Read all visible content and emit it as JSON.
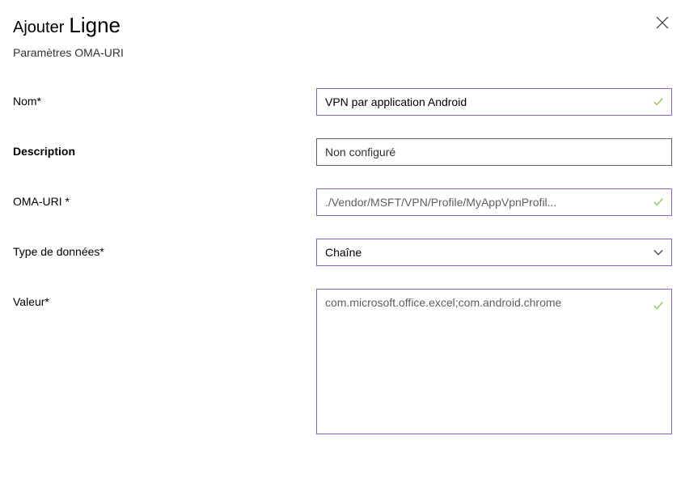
{
  "header": {
    "title_add": "Ajouter",
    "title_row": "Ligne",
    "subtitle": "Paramètres OMA-URI"
  },
  "form": {
    "name": {
      "label": "Nom*",
      "value": "VPN par application Android"
    },
    "description": {
      "label": "Description",
      "value": "Non configuré"
    },
    "oma_uri": {
      "label": "OMA-URI *",
      "value": "./Vendor/MSFT/VPN/Profile/MyAppVpnProfil..."
    },
    "data_type": {
      "label": "Type de données*",
      "value": "Chaîne"
    },
    "value": {
      "label": "Valeur*",
      "value": "com.microsoft.office.excel;com.android.chrome"
    }
  },
  "colors": {
    "accent": "#8661c5",
    "check": "#92c353"
  }
}
